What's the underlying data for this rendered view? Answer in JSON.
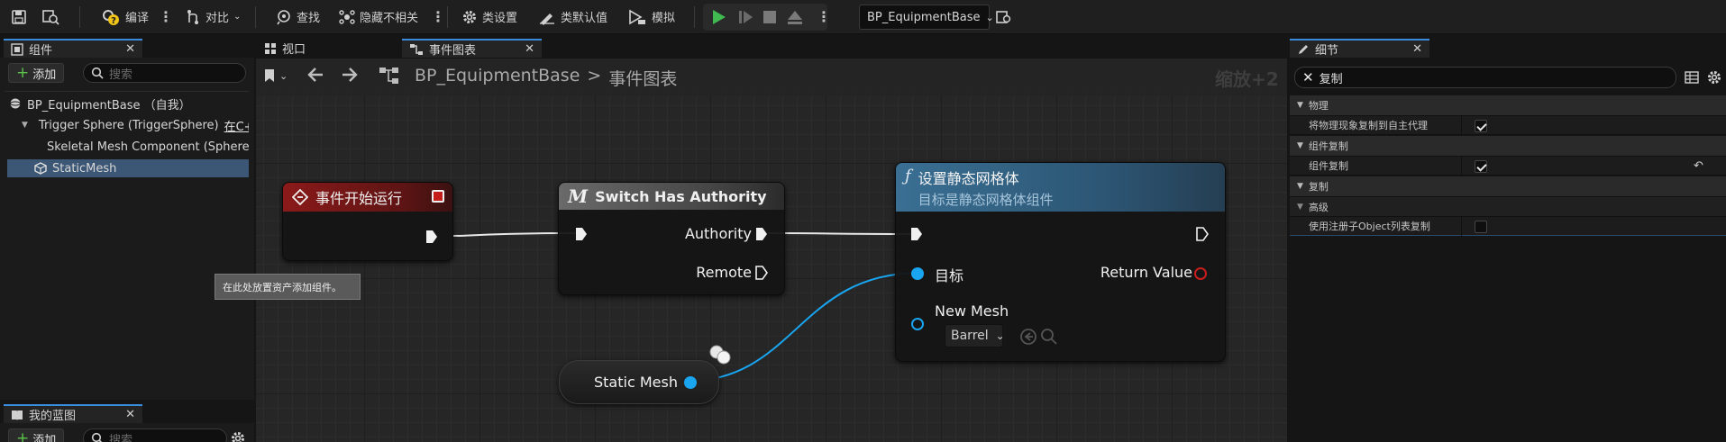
{
  "toolbar": {
    "compile_label": "编译",
    "diff_label": "对比",
    "find_label": "查找",
    "hide_unrelated_label": "隐藏不相关",
    "class_settings_label": "类设置",
    "class_defaults_label": "类默认值",
    "simulate_label": "模拟",
    "debug_object_value": "BP_EquipmentBase"
  },
  "components_panel": {
    "tab_label": "组件",
    "add_label": "添加",
    "search_placeholder": "搜索",
    "tree": [
      {
        "label": "BP_EquipmentBase （自我）"
      },
      {
        "label": "Trigger Sphere (TriggerSphere)",
        "suffix": "在C+"
      },
      {
        "label": "Skeletal Mesh Component (Sphere)"
      },
      {
        "label": "StaticMesh"
      }
    ],
    "tooltip": "在此处放置资产添加组件。"
  },
  "my_blueprint_panel": {
    "tab_label": "我的蓝图",
    "add_label": "添加",
    "search_placeholder": "搜索"
  },
  "editor_tabs": {
    "viewport_label": "视口",
    "event_graph_label": "事件图表"
  },
  "graph": {
    "breadcrumb_root": "BP_EquipmentBase",
    "breadcrumb_sep": ">",
    "breadcrumb_current": "事件图表",
    "zoom_label": "缩放+2",
    "nodes": {
      "begin_play": {
        "title": "事件开始运行"
      },
      "switch_authority": {
        "title": "Switch Has Authority",
        "pin_authority": "Authority",
        "pin_remote": "Remote"
      },
      "set_static_mesh": {
        "title": "设置静态网格体",
        "subtitle": "目标是静态网格体组件",
        "pin_target": "目标",
        "pin_return": "Return Value",
        "pin_new_mesh": "New Mesh",
        "mesh_value": "Barrel"
      },
      "static_mesh_var": {
        "title": "Static Mesh"
      }
    }
  },
  "details_panel": {
    "tab_label": "细节",
    "search_value": "复制",
    "rows": [
      {
        "type": "category",
        "label": "物理"
      },
      {
        "type": "property",
        "label": "将物理现象复制到自主代理",
        "checked": true
      },
      {
        "type": "category",
        "label": "组件复制"
      },
      {
        "type": "property",
        "label": "组件复制",
        "checked": true,
        "reset": true
      },
      {
        "type": "category",
        "label": "复制"
      },
      {
        "type": "category",
        "label": "高级"
      },
      {
        "type": "property",
        "label": "使用注册子Object列表复制",
        "checked": false
      }
    ]
  },
  "colors": {
    "accent": "#3a8dde",
    "event_header": "#8b1a1a",
    "function_header": "#2f5e7e",
    "macro_header": "#5a5a5a",
    "object_pin": "#19a5f0",
    "return_pin": "#c81e1e"
  }
}
